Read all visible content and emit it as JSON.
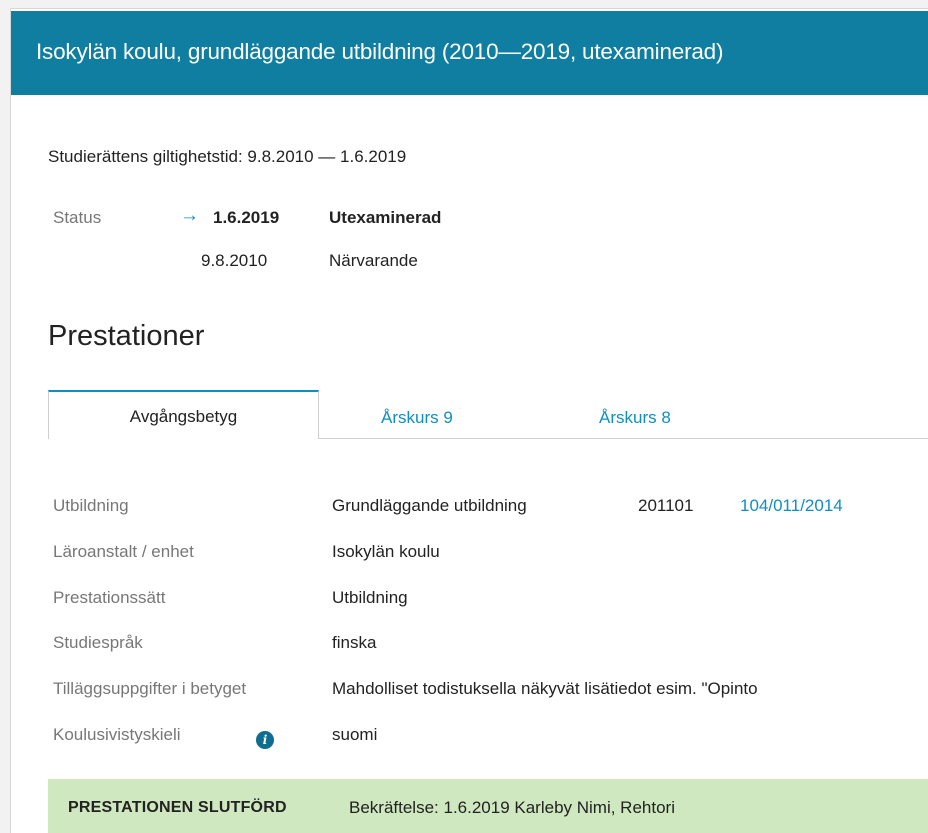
{
  "header": {
    "title": "Isokylän koulu, grundläggande utbildning (2010—2019, utexaminerad)"
  },
  "validity": {
    "text": "Studierättens giltighetstid: 9.8.2010 — 1.6.2019"
  },
  "status": {
    "label": "Status",
    "current_marker": "→",
    "entries": [
      {
        "date": "1.6.2019",
        "state": "Utexaminerad",
        "current": true
      },
      {
        "date": "9.8.2010",
        "state": "Närvarande",
        "current": false
      }
    ]
  },
  "section": {
    "title": "Prestationer"
  },
  "tabs": [
    {
      "label": "Avgångsbetyg",
      "active": true
    },
    {
      "label": "Årskurs 9",
      "active": false
    },
    {
      "label": "Årskurs 8",
      "active": false
    }
  ],
  "details": {
    "rows": [
      {
        "label": "Utbildning",
        "value": "Grundläggande utbildning",
        "code": "201101",
        "link": "104/011/2014"
      },
      {
        "label": "Läroanstalt / enhet",
        "value": "Isokylän koulu"
      },
      {
        "label": "Prestationssätt",
        "value": "Utbildning"
      },
      {
        "label": "Studiespråk",
        "value": "finska"
      },
      {
        "label": "Tilläggsuppgifter i betyget",
        "value": "Mahdolliset todistuksella näkyvät lisätiedot esim. \"Opinto"
      },
      {
        "label": "Koulusivistyskieli",
        "value": "suomi",
        "info_icon": "info-icon"
      }
    ]
  },
  "footer": {
    "title": "PRESTATIONEN SLUTFÖRD",
    "text": "Bekräftelse: 1.6.2019 Karleby   Nimi, Rehtori"
  },
  "colors": {
    "header_bg": "#0f7ea0",
    "link": "#0f8fc0",
    "footer_bg": "#cfe8bf",
    "label": "#777777"
  }
}
